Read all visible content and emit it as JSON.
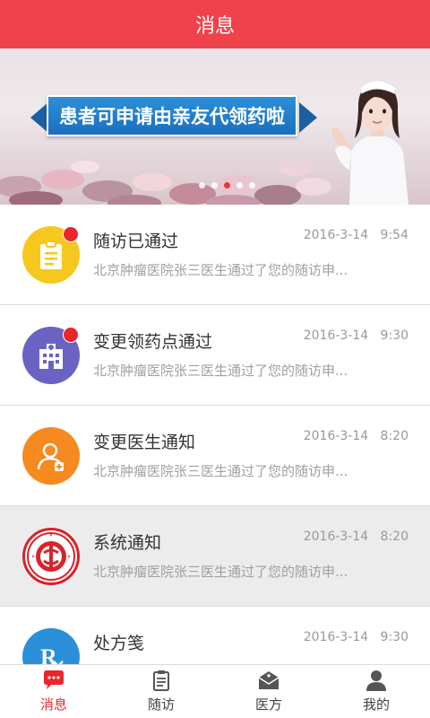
{
  "header": {
    "title": "消息"
  },
  "banner": {
    "ribbon_text": "患者可申请由亲友代领药啦",
    "dots": [
      false,
      false,
      true,
      false,
      false
    ]
  },
  "messages": [
    {
      "title": "随访已通过",
      "date": "2016-3-14",
      "time": "9:54",
      "preview": "北京肿瘤医院张三医生通过了您的随访申...",
      "unread": true,
      "icon": "clipboard-icon",
      "color": "#f6c81e"
    },
    {
      "title": "变更领药点通过",
      "date": "2016-3-14",
      "time": "9:30",
      "preview": "北京肿瘤医院张三医生通过了您的随访申...",
      "unread": true,
      "icon": "hospital-icon",
      "color": "#6a63c4"
    },
    {
      "title": "变更医生通知",
      "date": "2016-3-14",
      "time": "8:20",
      "preview": "北京肿瘤医院张三医生通过了您的随访申...",
      "unread": false,
      "icon": "doctor-icon",
      "color": "#f58a1f"
    },
    {
      "title": "系统通知",
      "date": "2016-3-14",
      "time": "8:20",
      "preview": "北京肿瘤医院张三医生通过了您的随访申...",
      "unread": false,
      "icon": "charity-logo",
      "color": "#d8232a"
    },
    {
      "title": "处方笺",
      "date": "2016-3-14",
      "time": "9:30",
      "preview": "",
      "unread": false,
      "icon": "prescription-icon",
      "color": "#2a8fd8"
    }
  ],
  "tabs": [
    {
      "label": "消息",
      "icon": "message-icon",
      "active": true
    },
    {
      "label": "随访",
      "icon": "clipboard-icon",
      "active": false
    },
    {
      "label": "医方",
      "icon": "envelope-icon",
      "active": false
    },
    {
      "label": "我的",
      "icon": "user-icon",
      "active": false
    }
  ],
  "colors": {
    "brand": "#f0424a",
    "badge": "#e8262c",
    "active_tab": "#e8262c"
  }
}
